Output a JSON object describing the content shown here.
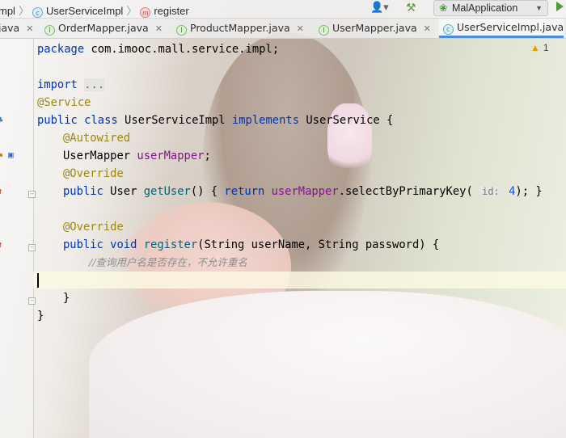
{
  "breadcrumb": {
    "pkg": "mpl",
    "class_name": "UserServiceImpl",
    "method_name": "register"
  },
  "toolbar": {
    "run_config": "MalApplication"
  },
  "tabs": [
    {
      "label": "java"
    },
    {
      "label": "OrderMapper.java",
      "type": "interface"
    },
    {
      "label": "ProductMapper.java",
      "type": "interface"
    },
    {
      "label": "UserMapper.java",
      "type": "interface"
    },
    {
      "label": "UserServiceImpl.java",
      "type": "class",
      "active": true
    }
  ],
  "inspections": {
    "warnings": "1"
  },
  "code": {
    "l1_kw": "package",
    "l1_rest": " com.imooc.mall.service.impl;",
    "l3_kw": "import",
    "l3_dots": "...",
    "l4_ann": "@Service",
    "l5_kw1": "public",
    "l5_kw2": "class",
    "l5_name": "UserServiceImpl",
    "l5_kw3": "implements",
    "l5_iface": "UserService {",
    "l6_ann": "@Autowired",
    "l7_type": "UserMapper",
    "l7_field": "userMapper",
    "l7_end": ";",
    "l8_ann": "@Override",
    "l9_kw": "public",
    "l9_type": "User",
    "l9_fn": "getUser",
    "l9_a": "() { ",
    "l9_ret": "return",
    "l9_field": "userMapper",
    "l9_call": ".selectByPrimaryKey(",
    "l9_hint": "id:",
    "l9_num": "4",
    "l9_end": "); }",
    "l11_ann": "@Override",
    "l12_kw1": "public",
    "l12_kw2": "void",
    "l12_fn": "register",
    "l12_params": "(String userName, String password) {",
    "l13_comment": "//查询用户名是否存在，不允许重名",
    "l15_brace": "}",
    "l16_brace": "}"
  },
  "colors": {
    "keyword": "#0033b3",
    "annotation": "#9e880d",
    "field": "#871094",
    "method": "#00627a",
    "comment": "#8c8c8c",
    "number": "#1750eb",
    "active_tab_underline": "#4b8ae3"
  }
}
